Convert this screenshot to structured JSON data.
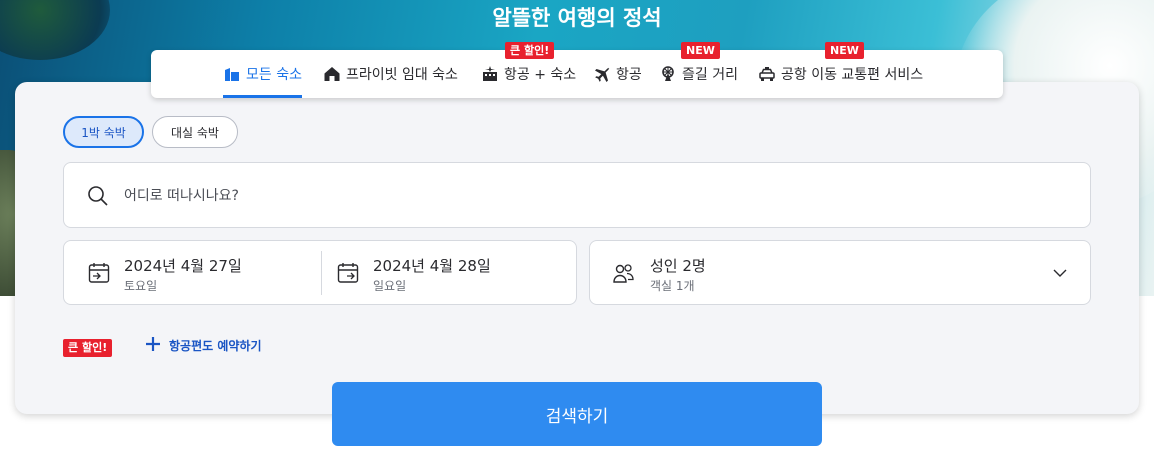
{
  "headline": "알뜰한 여행의 정석",
  "tabs": [
    {
      "label": "모든 숙소",
      "icon": "building-icon",
      "active": true
    },
    {
      "label": "프라이빗 임대 숙소",
      "icon": "house-icon"
    },
    {
      "label": "항공 + 숙소",
      "icon": "flight-hotel-icon",
      "badge": "큰 할인!"
    },
    {
      "label": "항공",
      "icon": "airplane-icon"
    },
    {
      "label": "즐길 거리",
      "icon": "ferris-wheel-icon",
      "badge": "NEW"
    },
    {
      "label": "공항 이동 교통편 서비스",
      "icon": "taxi-icon",
      "badge": "NEW"
    }
  ],
  "stay_type": {
    "one_night": "1박 숙박",
    "day_use": "대실 숙박"
  },
  "search": {
    "placeholder": "어디로 떠나시나요?"
  },
  "checkin": {
    "date": "2024년 4월 27일",
    "day": "토요일"
  },
  "checkout": {
    "date": "2024년 4월 28일",
    "day": "일요일"
  },
  "guests": {
    "main": "성인 2명",
    "sub": "객실 1개"
  },
  "promo": {
    "badge": "큰 할인!",
    "add_flight": "항공편도 예약하기"
  },
  "search_button": "검색하기",
  "colors": {
    "accent": "#1a73e8",
    "button": "#2f8bf0",
    "sale": "#e8212e"
  }
}
